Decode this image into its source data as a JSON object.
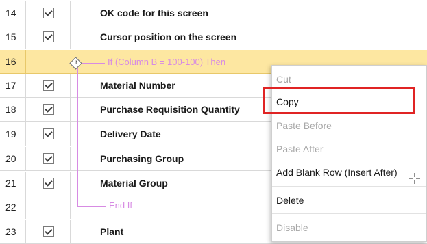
{
  "rows": [
    {
      "num": "14",
      "checked": true,
      "label": "OK code for this screen"
    },
    {
      "num": "15",
      "checked": true,
      "label": "Cursor position on the screen"
    },
    {
      "num": "16",
      "checked": false,
      "label": "",
      "selected": true
    },
    {
      "num": "17",
      "checked": true,
      "label": "Material Number"
    },
    {
      "num": "18",
      "checked": true,
      "label": "Purchase Requisition Quantity"
    },
    {
      "num": "19",
      "checked": true,
      "label": "Delivery Date"
    },
    {
      "num": "20",
      "checked": true,
      "label": "Purchasing Group"
    },
    {
      "num": "21",
      "checked": true,
      "label": "Material Group"
    },
    {
      "num": "22",
      "checked": false,
      "label": ""
    },
    {
      "num": "23",
      "checked": true,
      "label": "Plant"
    }
  ],
  "condition": {
    "if_text": "If (Column B = 100-100) Then",
    "end_text": "End If",
    "glyph": "if"
  },
  "context_menu": {
    "cut": "Cut",
    "copy": "Copy",
    "paste_before": "Paste Before",
    "paste_after": "Paste After",
    "add_blank_row": "Add Blank Row (Insert After)",
    "delete": "Delete",
    "disable": "Disable"
  },
  "colors": {
    "selected_row": "#fde7a1",
    "condition": "#d78be3",
    "highlight": "#e02424"
  },
  "icons": {
    "checkbox": "checkbox-checked-icon",
    "condition": "condition-diamond-icon",
    "cursor": "crosshair-cursor-icon"
  }
}
